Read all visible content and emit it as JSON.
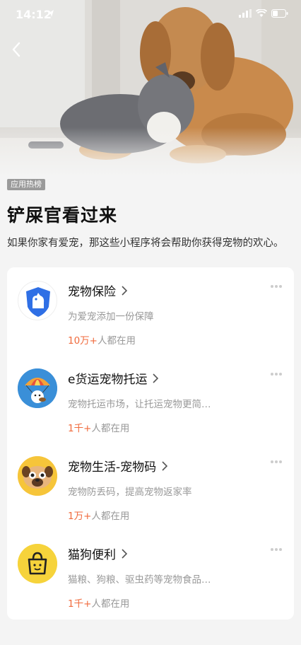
{
  "status": {
    "time": "14:12"
  },
  "page": {
    "tag": "应用热榜",
    "title": "铲屎官看过来",
    "subtitle": "如果你家有爱宠，那这些小程序将会帮助你获得宠物的欢心。"
  },
  "items": [
    {
      "name": "宠物保险",
      "desc": "为爱宠添加一份保障",
      "users_count": "10万+",
      "users_suffix": "人都在用",
      "icon": "dog-shield-icon"
    },
    {
      "name": "e货运宠物托运",
      "desc": "宠物托运市场，让托运宠物更简…",
      "users_count": "1千+",
      "users_suffix": "人都在用",
      "icon": "parachute-dog-icon"
    },
    {
      "name": "宠物生活-宠物码",
      "desc": "宠物防丢码，提高宠物返家率",
      "users_count": "1万+",
      "users_suffix": "人都在用",
      "icon": "pug-face-icon"
    },
    {
      "name": "猫狗便利",
      "desc": "猫粮、狗粮、驱虫药等宠物食品…",
      "users_count": "1千+",
      "users_suffix": "人都在用",
      "icon": "shopping-bag-icon"
    }
  ],
  "colors": {
    "accent": "#f06a3c",
    "shield_blue": "#2f6fe5",
    "yellow": "#f6d33b"
  }
}
